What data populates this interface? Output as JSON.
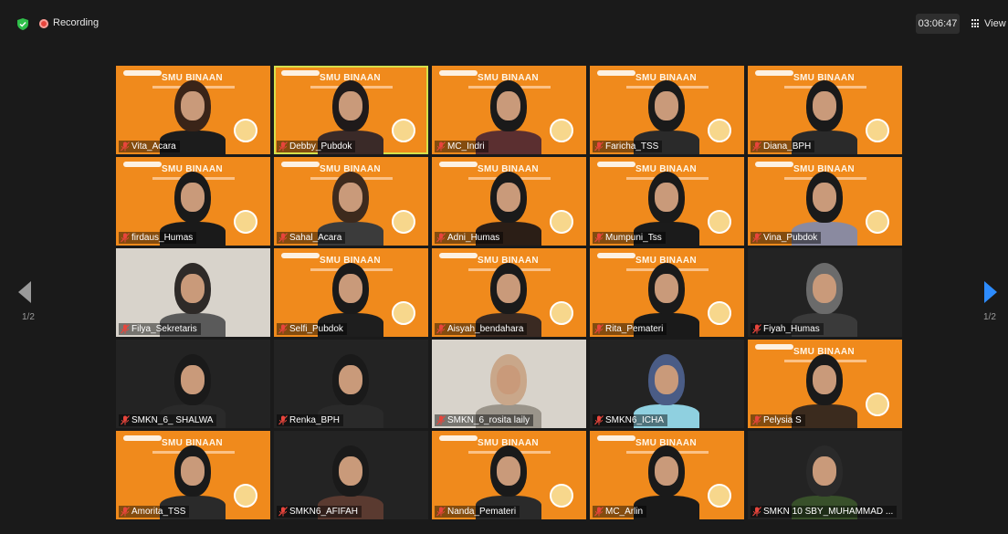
{
  "toolbar": {
    "recording_label": "Recording",
    "timer": "03:06:47",
    "view_label": "View"
  },
  "pager": {
    "left": "1/2",
    "right": "1/2"
  },
  "banner": {
    "title": "SMU BINAAN"
  },
  "tiles": [
    {
      "name": "Vita_Acara"
    },
    {
      "name": "Debby_Pubdok"
    },
    {
      "name": "MC_Indri"
    },
    {
      "name": "Faricha_TSS"
    },
    {
      "name": "Diana_BPH"
    },
    {
      "name": "firdaus_Humas"
    },
    {
      "name": "Sahal_Acara"
    },
    {
      "name": "Adni_Humas"
    },
    {
      "name": "Mumpuni_Tss"
    },
    {
      "name": "Vina_Pubdok"
    },
    {
      "name": "Filya_Sekretaris"
    },
    {
      "name": "Selfi_Pubdok"
    },
    {
      "name": "Aisyah_bendahara"
    },
    {
      "name": "Rita_Pemateri"
    },
    {
      "name": "Fiyah_Humas"
    },
    {
      "name": "SMKN_6_ SHALWA"
    },
    {
      "name": "Renka_BPH"
    },
    {
      "name": "SMKN_6_rosita laily"
    },
    {
      "name": "SMKN6_ICHA"
    },
    {
      "name": "Pelysia S"
    },
    {
      "name": "Amorita_TSS"
    },
    {
      "name": "SMKN6_AFIFAH"
    },
    {
      "name": "Nanda_Pemateri"
    },
    {
      "name": "MC_Arlin"
    },
    {
      "name": "SMKN 10 SBY_MUHAMMAD ..."
    }
  ],
  "colors": {
    "background": "#1a1a1a",
    "banner_orange": "#f08a1c",
    "recording_red": "#e8453c",
    "mic_muted": "#e8453c",
    "active_speaker": "#d6e04a",
    "shield_green": "#2fbf4a",
    "nav_prev": "#9a9a9a",
    "nav_next": "#2d8cff"
  }
}
